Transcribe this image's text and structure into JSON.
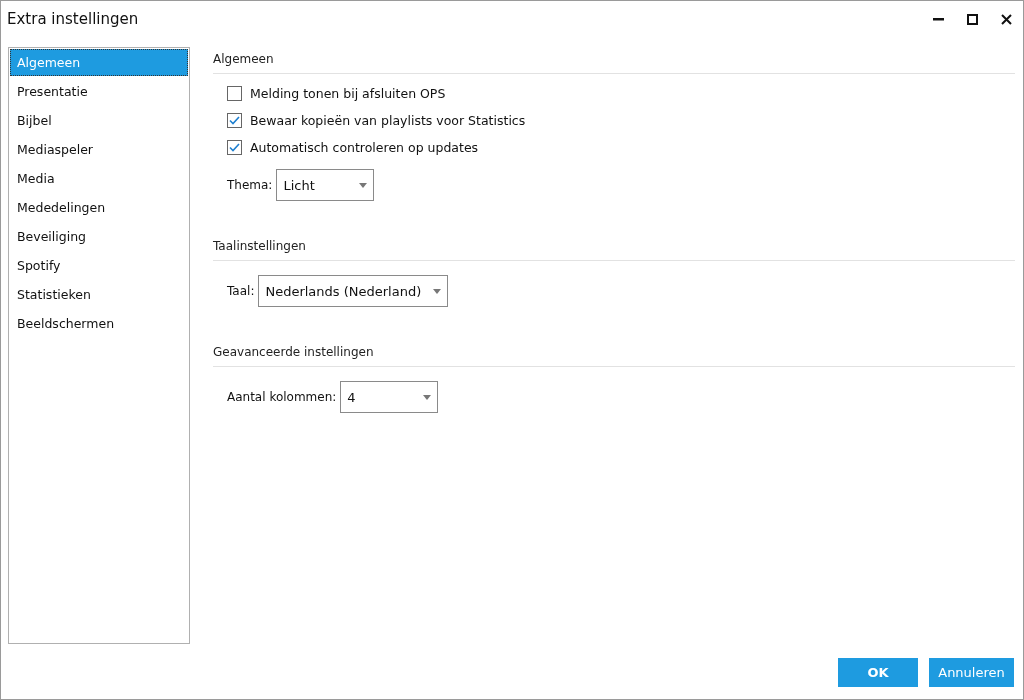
{
  "window": {
    "title": "Extra instellingen"
  },
  "sidebar": {
    "items": [
      {
        "label": "Algemeen",
        "selected": true
      },
      {
        "label": "Presentatie",
        "selected": false
      },
      {
        "label": "Bijbel",
        "selected": false
      },
      {
        "label": "Mediaspeler",
        "selected": false
      },
      {
        "label": "Media",
        "selected": false
      },
      {
        "label": "Mededelingen",
        "selected": false
      },
      {
        "label": "Beveiliging",
        "selected": false
      },
      {
        "label": "Spotify",
        "selected": false
      },
      {
        "label": "Statistieken",
        "selected": false
      },
      {
        "label": "Beeldschermen",
        "selected": false
      }
    ]
  },
  "sections": [
    {
      "title": "Algemeen",
      "controls": [
        {
          "kind": "checkbox",
          "label": "Melding tonen bij afsluiten OPS",
          "checked": false
        },
        {
          "kind": "checkbox",
          "label": "Bewaar kopieën van playlists voor Statistics",
          "checked": true
        },
        {
          "kind": "checkbox",
          "label": "Automatisch controleren op updates",
          "checked": true
        },
        {
          "kind": "select",
          "label": "Thema:",
          "value": "Licht"
        }
      ]
    },
    {
      "title": "Taalinstellingen",
      "controls": [
        {
          "kind": "select",
          "label": "Taal:",
          "value": "Nederlands (Nederland)"
        }
      ]
    },
    {
      "title": "Geavanceerde instellingen",
      "controls": [
        {
          "kind": "select",
          "label": "Aantal kolommen:",
          "value": "4"
        }
      ]
    }
  ],
  "buttons": [
    "OK",
    "Annuleren"
  ]
}
